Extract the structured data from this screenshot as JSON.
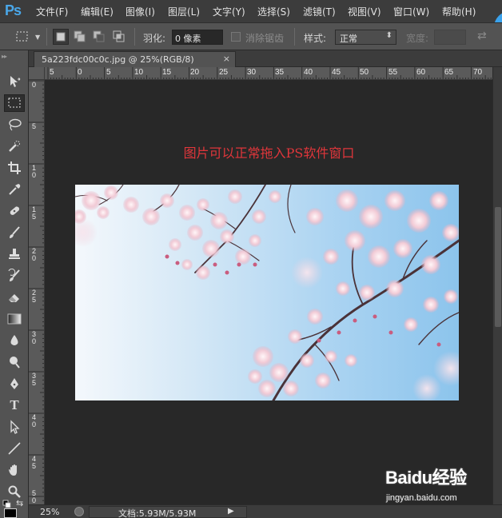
{
  "app": {
    "logo": "Ps"
  },
  "menu": {
    "items": [
      {
        "label": "文件(F)"
      },
      {
        "label": "编辑(E)"
      },
      {
        "label": "图像(I)"
      },
      {
        "label": "图层(L)"
      },
      {
        "label": "文字(Y)"
      },
      {
        "label": "选择(S)"
      },
      {
        "label": "滤镜(T)"
      },
      {
        "label": "视图(V)"
      },
      {
        "label": "窗口(W)"
      },
      {
        "label": "帮助(H)"
      }
    ]
  },
  "options_bar": {
    "feather_label": "羽化:",
    "feather_value": "0 像素",
    "antialias_label": "消除锯齿",
    "antialias_checked": false,
    "style_label": "样式:",
    "style_value": "正常",
    "width_label": "宽度:"
  },
  "document": {
    "tab_title": "5a223fdc00c0c.jpg @ 25%(RGB/8)",
    "close_glyph": "×",
    "caption": "图片可以正常拖入PS软件窗口"
  },
  "ruler": {
    "top_labels": [
      "5",
      "0",
      "5",
      "10",
      "15",
      "20",
      "25",
      "30",
      "35",
      "40",
      "45",
      "50",
      "55",
      "60",
      "65",
      "70"
    ],
    "left_labels": [
      "0",
      "5",
      "10",
      "15",
      "20",
      "25",
      "30",
      "35",
      "40",
      "45",
      "50"
    ]
  },
  "status": {
    "zoom": "25%",
    "doc_info": "文档:5.93M/5.93M",
    "arrow": "▶"
  },
  "watermark": {
    "brand": "Baidu经验",
    "url": "jingyan.baidu.com"
  },
  "colors": {
    "caption": "#e0363b",
    "ps_blue": "#4aa7e9",
    "ui_dark": "#282828",
    "panel": "#535353"
  }
}
